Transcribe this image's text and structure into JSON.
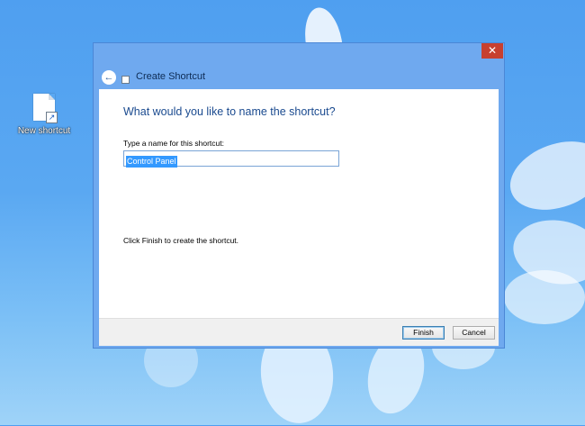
{
  "desktop": {
    "shortcut_label": "New shortcut"
  },
  "dialog": {
    "title": "Create Shortcut",
    "close_glyph": "✕",
    "back_glyph": "←",
    "heading": "What would you like to name the shortcut?",
    "field_label": "Type a name for this shortcut:",
    "name_value": "Control Panel",
    "hint": "Click Finish to create the shortcut.",
    "finish_label": "Finish",
    "cancel_label": "Cancel"
  },
  "colors": {
    "title_accent": "#1a4a8f",
    "close_button": "#c7402f",
    "selection": "#3399ff"
  }
}
